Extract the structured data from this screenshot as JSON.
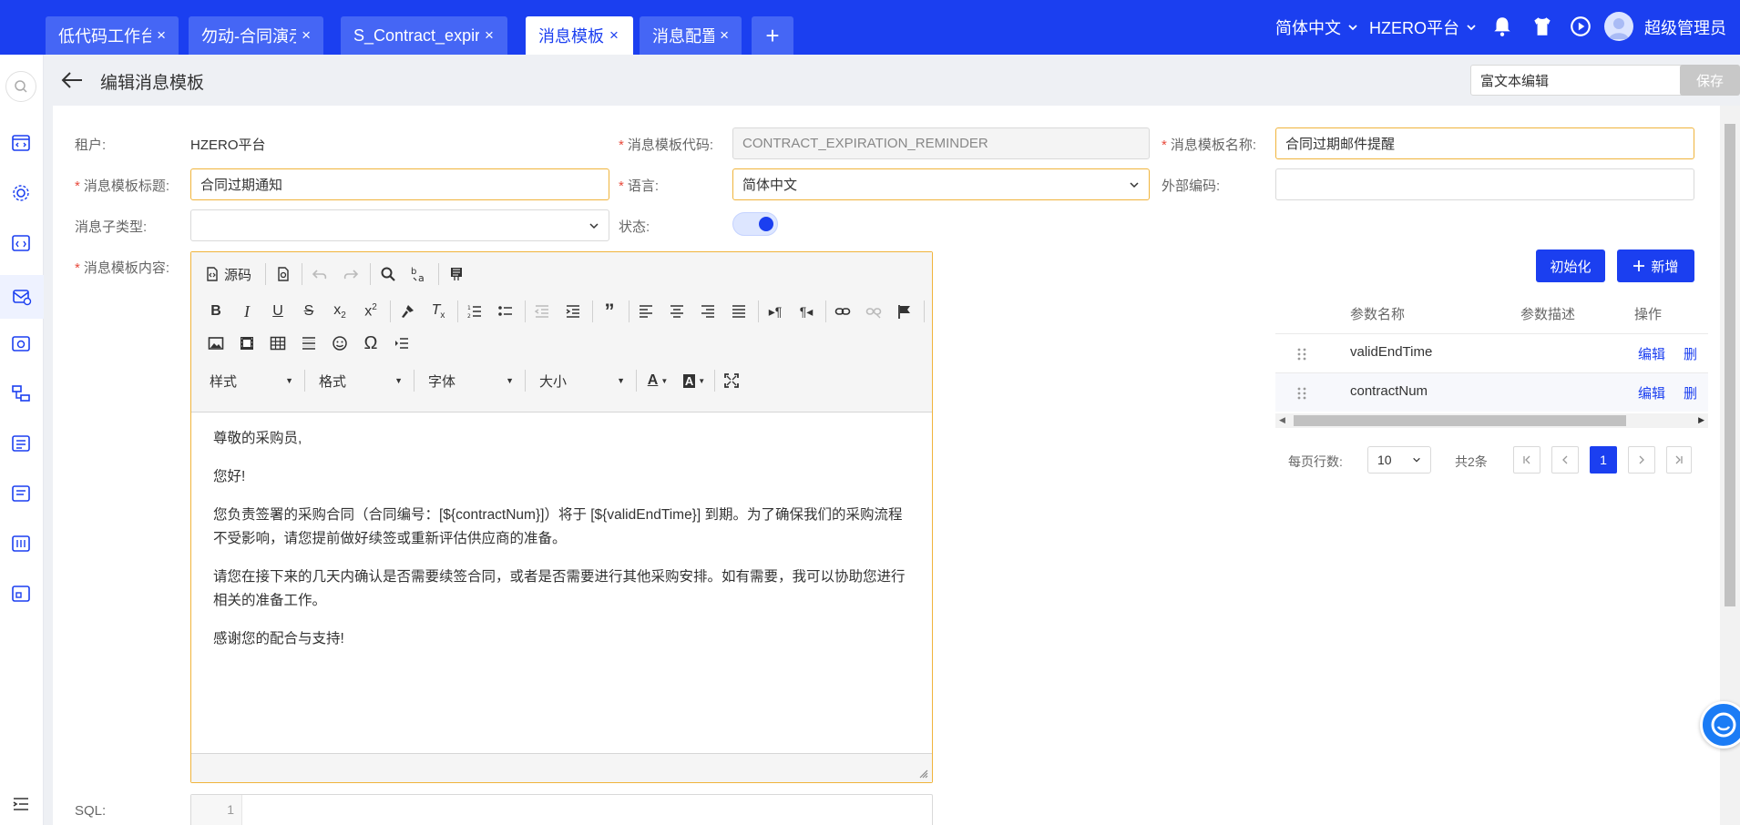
{
  "tabs": [
    {
      "label": "低代码工作台",
      "active": false
    },
    {
      "label": "勿动-合同演示",
      "active": false
    },
    {
      "label": "S_Contract_expira",
      "active": false
    },
    {
      "label": "消息模板",
      "active": true
    },
    {
      "label": "消息配置",
      "active": false
    }
  ],
  "tab_close": "×",
  "tab_add": "+",
  "topbar": {
    "language": "简体中文",
    "platform": "HZERO平台",
    "user": "超级管理员"
  },
  "header": {
    "title": "编辑消息模板",
    "mode": "富文本编辑",
    "save_label": "保存"
  },
  "form": {
    "tenant_label": "租户:",
    "tenant_value": "HZERO平台",
    "code_label": "消息模板代码:",
    "code_value": "CONTRACT_EXPIRATION_REMINDER",
    "name_label": "消息模板名称:",
    "name_value": "合同过期邮件提醒",
    "title_label": "消息模板标题:",
    "title_value": "合同过期通知",
    "lang_label": "语言:",
    "lang_value": "简体中文",
    "ext_label": "外部编码:",
    "ext_value": "",
    "subtype_label": "消息子类型:",
    "subtype_value": "",
    "status_label": "状态:",
    "status_on": true,
    "content_label": "消息模板内容:",
    "sql_label": "SQL:"
  },
  "editor": {
    "source_label": "源码",
    "style_label": "样式",
    "format_label": "格式",
    "font_label": "字体",
    "size_label": "大小",
    "paragraphs": [
      "尊敬的采购员,",
      "您好!",
      "您负责签署的采购合同（合同编号：[${contractNum}]）将于 [${validEndTime}] 到期。为了确保我们的采购流程不受影响，请您提前做好续签或重新评估供应商的准备。",
      "请您在接下来的几天内确认是否需要续签合同，或者是否需要进行其他采购安排。如有需要，我可以协助您进行相关的准备工作。",
      "感谢您的配合与支持!"
    ]
  },
  "sql": {
    "line_number": "1"
  },
  "params": {
    "init_label": "初始化",
    "add_label": "新增",
    "columns": [
      "参数名称",
      "参数描述",
      "操作"
    ],
    "rows": [
      {
        "name": "validEndTime",
        "desc": "",
        "edit": "编辑",
        "delete": "删"
      },
      {
        "name": "contractNum",
        "desc": "",
        "edit": "编辑",
        "delete": "删"
      }
    ],
    "pager": {
      "rows_label": "每页行数:",
      "rows_value": "10",
      "total": "共2条",
      "current": "1"
    }
  },
  "colors": {
    "brand": "#1b3ff0",
    "required_border": "#f0b43c",
    "required_star": "#e84a3c"
  }
}
